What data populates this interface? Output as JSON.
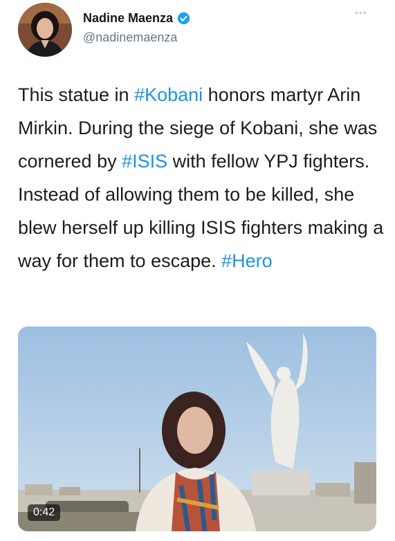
{
  "author": {
    "name": "Nadine Maenza",
    "handle": "@nadinemaenza",
    "avatar_icon": "profile-photo",
    "verified_icon": "verified-badge-icon"
  },
  "tweet": {
    "segments": [
      {
        "text": "This statue in ",
        "type": "text"
      },
      {
        "text": "#Kobani",
        "type": "hashtag"
      },
      {
        "text": " honors martyr Arin Mirkin. During the siege of Kobani, she was cornered by ",
        "type": "text"
      },
      {
        "text": "#ISIS",
        "type": "hashtag"
      },
      {
        "text": " with fellow YPJ fighters. Instead of allowing them to be killed, she blew herself up killing ISIS fighters making a way for them  to escape. ",
        "type": "text"
      },
      {
        "text": "#Hero",
        "type": "hashtag"
      }
    ]
  },
  "media": {
    "duration": "0:42"
  },
  "colors": {
    "hashtag": "#1b95e0",
    "verified": "#1da1f2",
    "handle": "#657786"
  }
}
